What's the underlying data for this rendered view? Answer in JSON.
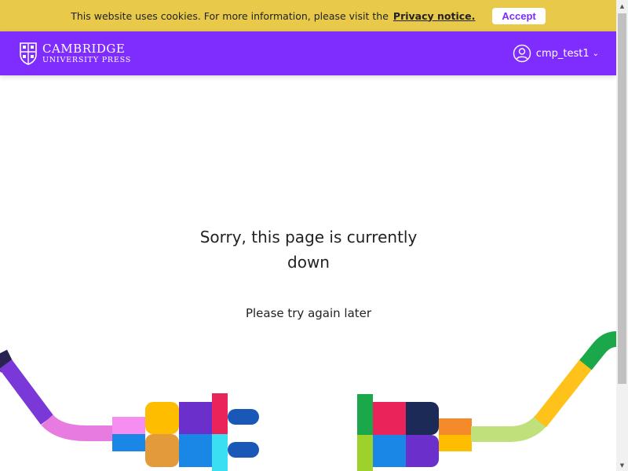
{
  "cookie": {
    "text": "This website uses cookies. For more information, please visit the",
    "link": "Privacy notice.",
    "accept": "Accept"
  },
  "header": {
    "brand_line1": "CAMBRIDGE",
    "brand_line2": "UNIVERSITY PRESS",
    "username": "cmp_test1"
  },
  "message": {
    "title": "Sorry, this page is currently down",
    "subtitle": "Please try again later"
  },
  "colors": {
    "header": "#7f2dff",
    "cookie_bar": "#e8c94a",
    "accept_text": "#7a2dff"
  },
  "icons": [
    "university-crest-icon",
    "user-circle-icon",
    "chevron-down-icon",
    "unplugged-plug-illustration"
  ]
}
